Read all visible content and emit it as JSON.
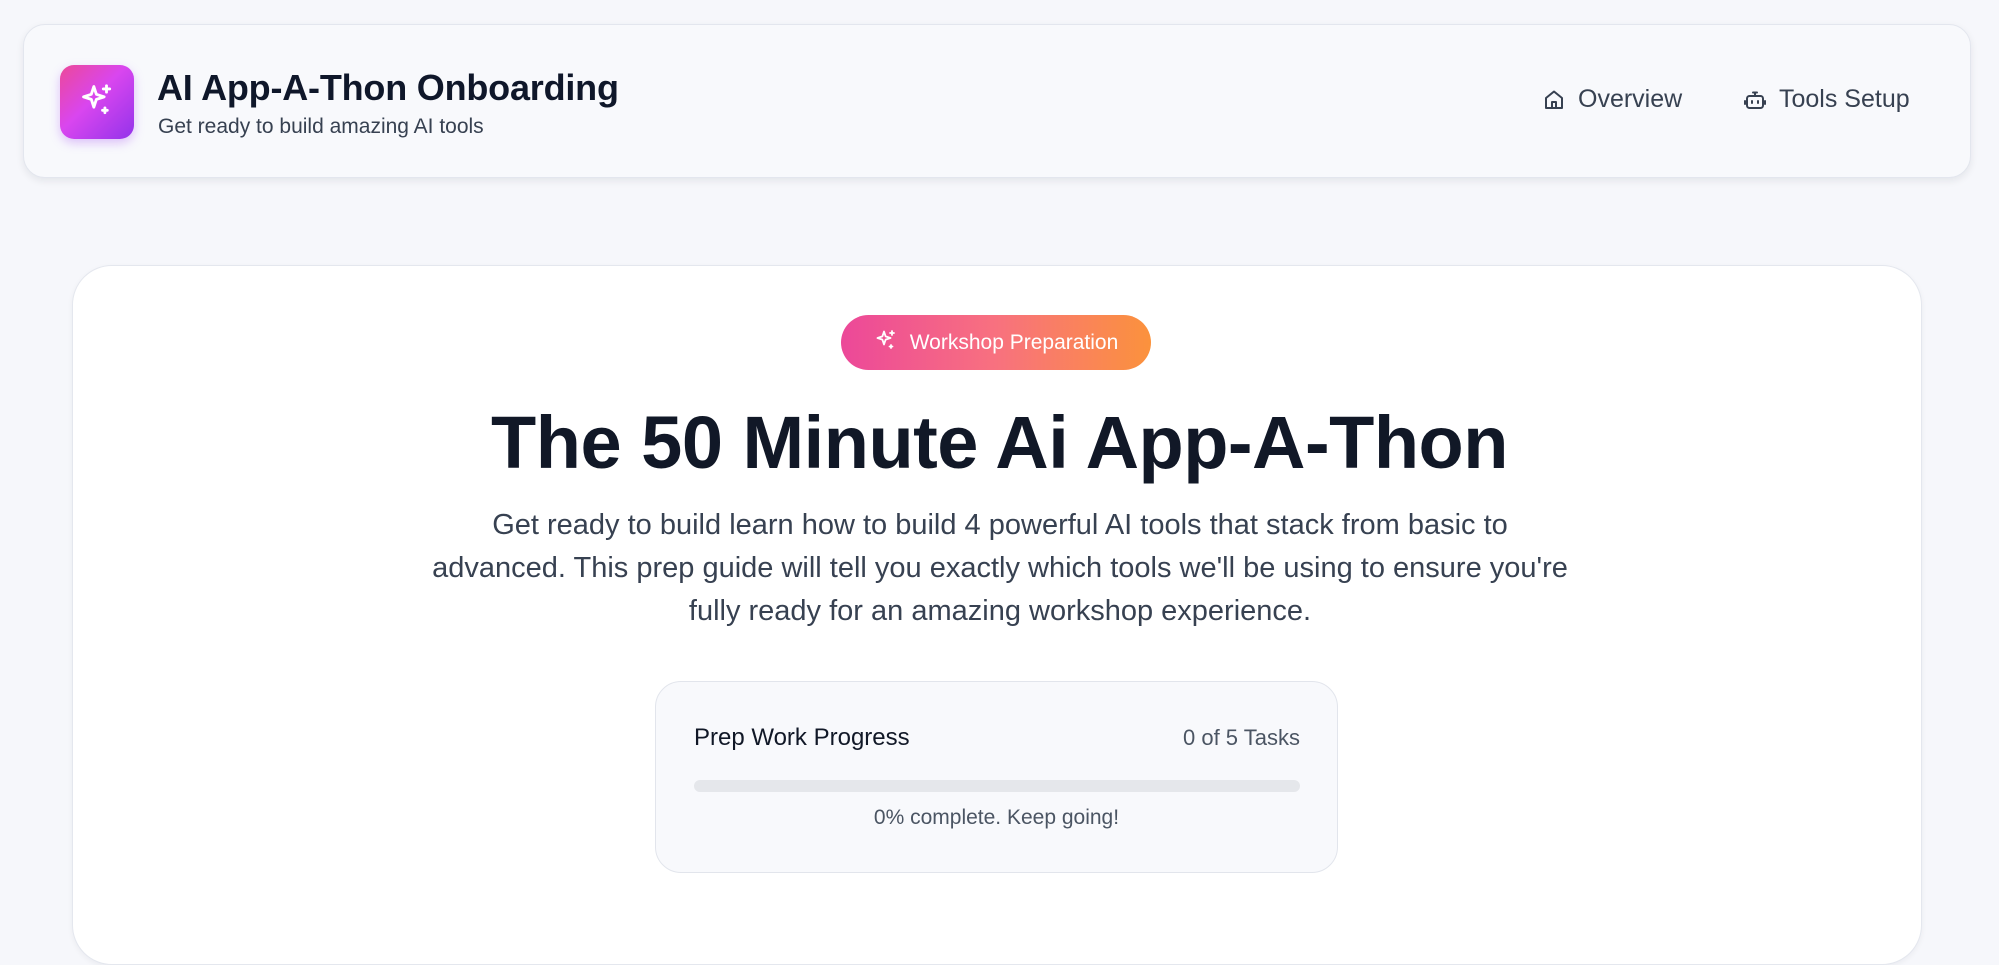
{
  "header": {
    "logo_icon": "sparkles-icon",
    "title": "AI App-A-Thon Onboarding",
    "subtitle": "Get ready to build amazing AI tools",
    "nav": [
      {
        "label": "Overview",
        "icon": "home-icon"
      },
      {
        "label": "Tools Setup",
        "icon": "bot-icon"
      }
    ]
  },
  "hero": {
    "badge": {
      "label": "Workshop Preparation",
      "icon": "sparkles-icon"
    },
    "title": "The 50 Minute Ai App-A-Thon",
    "description": "Get ready to build learn how to build 4 powerful AI tools that stack from basic to advanced. This prep guide will tell you exactly which tools we'll be using to ensure you're fully ready for an amazing workshop experience."
  },
  "progress": {
    "label": "Prep Work Progress",
    "count_text": "0 of 5 Tasks",
    "completed": 0,
    "total": 5,
    "percent": 0,
    "note": "0% complete. Keep going!"
  },
  "colors": {
    "logo_gradient": [
      "#ec4899",
      "#9333ea"
    ],
    "badge_gradient": [
      "#ec4899",
      "#fb923c"
    ],
    "text_dark": "#111827",
    "text_muted": "#374151",
    "background": "#f6f7fb"
  }
}
